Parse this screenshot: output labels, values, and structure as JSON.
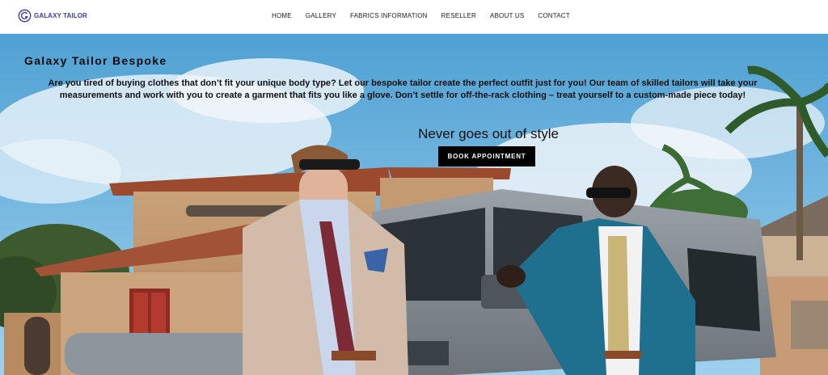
{
  "brand": {
    "name": "GALAXY TAILOR",
    "logo_icon": "galaxy-circle-logo-icon",
    "color": "#3b3b9c"
  },
  "nav": {
    "items": [
      {
        "label": "HOME"
      },
      {
        "label": "GALLERY"
      },
      {
        "label": "FABRICS INFORMATION"
      },
      {
        "label": "RESELLER"
      },
      {
        "label": "ABOUT US"
      },
      {
        "label": "CONTACT"
      }
    ]
  },
  "hero": {
    "title": "Galaxy Tailor Bespoke",
    "description": "Are you tired of buying clothes that don’t fit your unique body type? Let our bespoke tailor create the perfect outfit just for you! Our team of skilled tailors will take your measurements and work with you to create a garment that fits you like a glove. Don’t settle for off-the-rack clothing – treat yourself to a custom-made piece today!",
    "tagline": "Never goes out of style",
    "cta_label": "BOOK APPOINTMENT",
    "image_subject": "two-men-in-suits-by-vehicle-photo"
  },
  "colors": {
    "sky": "#5ea9d6",
    "cta_background": "#000000",
    "cta_text": "#ffffff"
  }
}
